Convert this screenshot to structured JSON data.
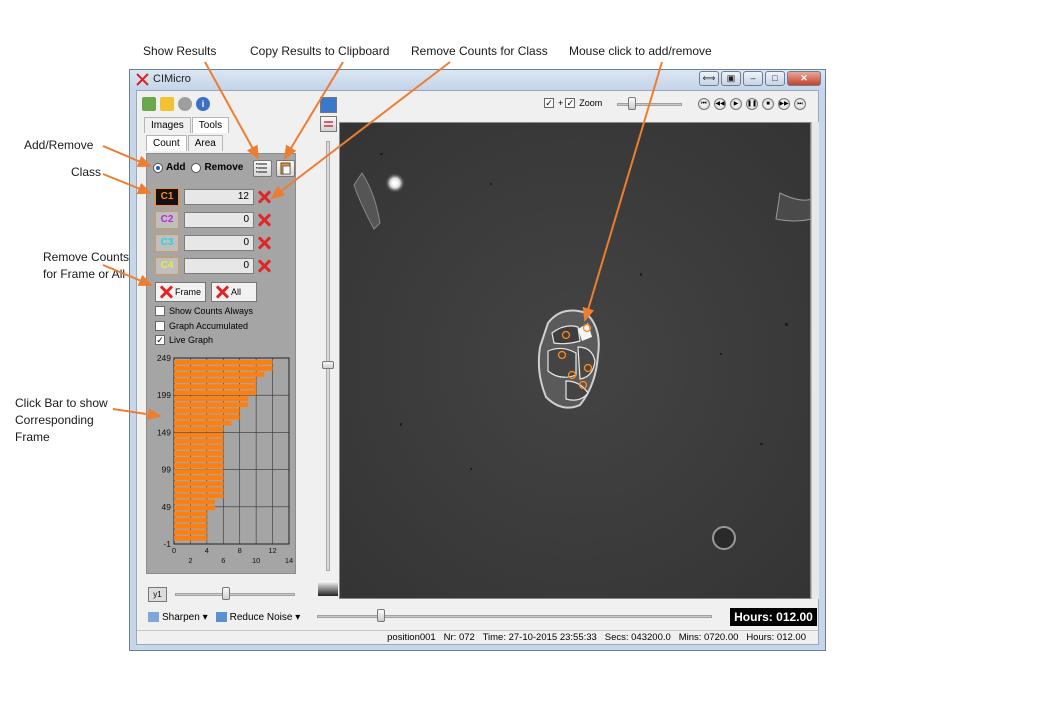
{
  "annotations": {
    "show_results": "Show Results",
    "copy_results": "Copy Results to Clipboard",
    "remove_counts_class": "Remove Counts for Class",
    "mouse_click": "Mouse click to add/remove",
    "add_remove": "Add/Remove",
    "class": "Class",
    "remove_frame_line1": "Remove Counts",
    "remove_frame_line2": "for Frame or All",
    "click_bar_line1": "Click Bar to show",
    "click_bar_line2": "Corresponding",
    "click_bar_line3": "Frame"
  },
  "window": {
    "title": "CIMicro"
  },
  "tabs": {
    "images": "Images",
    "tools": "Tools",
    "count": "Count",
    "area": "Area"
  },
  "mode": {
    "add_label": "Add",
    "remove_label": "Remove",
    "selected": "Add"
  },
  "classes": [
    {
      "label": "C1",
      "count": "12",
      "color": "#ff8a1a",
      "bg": "#111111"
    },
    {
      "label": "C2",
      "count": "0",
      "color": "#c026d3",
      "bg": "#bfbfbf"
    },
    {
      "label": "C3",
      "count": "0",
      "color": "#22d3ee",
      "bg": "#bfbfbf"
    },
    {
      "label": "C4",
      "count": "0",
      "color": "#e8e84a",
      "bg": "#bfbfbf"
    }
  ],
  "buttons": {
    "frame": "Frame",
    "all": "All",
    "y1": "y1"
  },
  "checkboxes": [
    {
      "label": "Show Counts Always",
      "checked": false
    },
    {
      "label": "Graph Accumulated",
      "checked": false
    },
    {
      "label": "Live Graph",
      "checked": true
    }
  ],
  "chart_data": {
    "type": "bar",
    "orientation": "horizontal",
    "y_ticks": [
      "249",
      "199",
      "149",
      "99",
      "49",
      "-1"
    ],
    "x_ticks_top": [
      "0",
      "4",
      "8",
      "12"
    ],
    "x_ticks_bottom": [
      "2",
      "6",
      "10",
      "14"
    ],
    "xlim": [
      0,
      14
    ],
    "ylim": [
      -1,
      249
    ],
    "bar_color": "#ff7f0e",
    "values": [
      12,
      12,
      11,
      10,
      10,
      10,
      9,
      9,
      8,
      8,
      7,
      6,
      6,
      6,
      6,
      6,
      6,
      6,
      6,
      6,
      6,
      6,
      6,
      5,
      5,
      4,
      4,
      4,
      4,
      4
    ]
  },
  "bottom_tools": {
    "sharpen": "Sharpen",
    "reduce_noise": "Reduce Noise"
  },
  "zoom_label": "Zoom",
  "hours_display": "Hours: 012.00",
  "status": {
    "position": "position001",
    "nr": "Nr: 072",
    "time": "Time: 27-10-2015 23:55:33",
    "secs": "Secs: 043200.0",
    "mins": "Mins: 0720.00",
    "hours": "Hours: 012.00"
  }
}
